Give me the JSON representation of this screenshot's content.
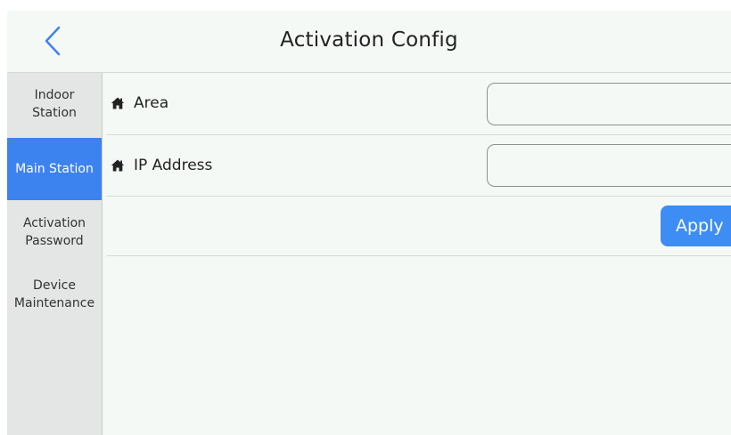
{
  "header": {
    "title": "Activation Config",
    "back_icon": "chevron-left-icon"
  },
  "sidebar": {
    "items": [
      {
        "label": "Indoor\nStation",
        "active": false
      },
      {
        "label": "Main Station",
        "active": true
      },
      {
        "label": "Activation\nPassword",
        "active": false
      },
      {
        "label": "Device\nMaintenance",
        "active": false
      }
    ]
  },
  "form": {
    "area": {
      "label": "Area",
      "value": "",
      "icon": "home-icon"
    },
    "ip_address": {
      "label": "IP Address",
      "value": "",
      "icon": "home-icon"
    },
    "apply_label": "Apply"
  },
  "colors": {
    "accent": "#3d83f0",
    "apply_button": "#3d8df5",
    "background": "#f5f9f6",
    "sidebar": "#e3e6e4"
  }
}
